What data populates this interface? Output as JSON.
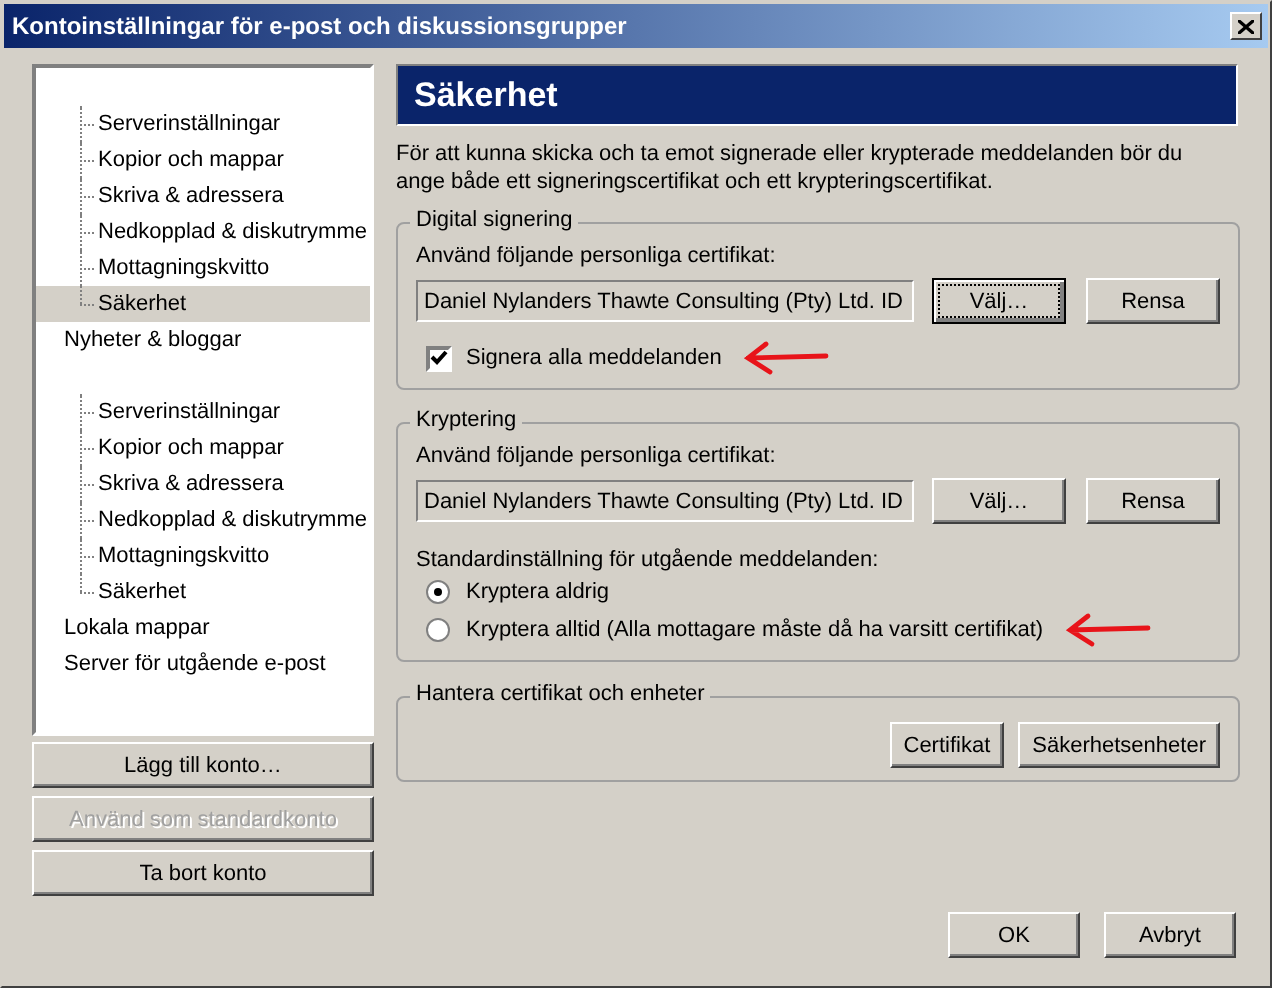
{
  "window": {
    "title": "Kontoinställningar för e-post och diskussionsgrupper"
  },
  "tree": [
    {
      "children": [
        {
          "label": "Serverinställningar",
          "selected": false
        },
        {
          "label": "Kopior och mappar",
          "selected": false
        },
        {
          "label": "Skriva & adressera",
          "selected": false
        },
        {
          "label": "Nedkopplad & diskutrymme",
          "selected": false
        },
        {
          "label": "Mottagningskvitto",
          "selected": false
        },
        {
          "label": "Säkerhet",
          "selected": true
        }
      ]
    },
    {
      "label": "Nyheter & bloggar",
      "selected": false
    },
    {
      "children": [
        {
          "label": "Serverinställningar",
          "selected": false
        },
        {
          "label": "Kopior och mappar",
          "selected": false
        },
        {
          "label": "Skriva & adressera",
          "selected": false
        },
        {
          "label": "Nedkopplad & diskutrymme",
          "selected": false
        },
        {
          "label": "Mottagningskvitto",
          "selected": false
        },
        {
          "label": "Säkerhet",
          "selected": false
        }
      ]
    },
    {
      "label": "Lokala mappar",
      "selected": false
    },
    {
      "label": "Server för utgående e-post",
      "selected": false
    }
  ],
  "account_buttons": [
    {
      "label": "Lägg till konto…",
      "disabled": false
    },
    {
      "label": "Använd som standardkonto",
      "disabled": true
    },
    {
      "label": "Ta bort konto",
      "disabled": false
    }
  ],
  "panel": {
    "title": "Säkerhet",
    "description": "För att kunna skicka och ta emot signerade eller krypterade meddelanden bör du ange både ett signeringscertifikat och ett krypteringscertifikat.",
    "signing": {
      "title": "Digital signering",
      "cert_label": "Använd följande personliga certifikat:",
      "cert_value": "Daniel Nylanders Thawte Consulting (Pty) Ltd. ID",
      "buttons": [
        {
          "label": "Välj…",
          "focused": true
        },
        {
          "label": "Rensa",
          "focused": false
        }
      ],
      "checkbox": {
        "label": "Signera alla meddelanden",
        "checked": true
      }
    },
    "encryption": {
      "title": "Kryptering",
      "cert_label": "Använd följande personliga certifikat:",
      "cert_value": "Daniel Nylanders Thawte Consulting (Pty) Ltd. ID",
      "buttons": [
        {
          "label": "Välj…",
          "focused": false
        },
        {
          "label": "Rensa",
          "focused": false
        }
      ],
      "default_label": "Standardinställning för utgående meddelanden:",
      "options": [
        {
          "label": "Kryptera aldrig",
          "selected": true
        },
        {
          "label": "Kryptera alltid (Alla mottagare måste då ha varsitt certifikat)",
          "selected": false
        }
      ]
    },
    "manage": {
      "title": "Hantera certifikat och enheter",
      "buttons": [
        "Certifikat",
        "Säkerhetsenheter"
      ]
    }
  },
  "footer_buttons": [
    "OK",
    "Avbryt"
  ]
}
